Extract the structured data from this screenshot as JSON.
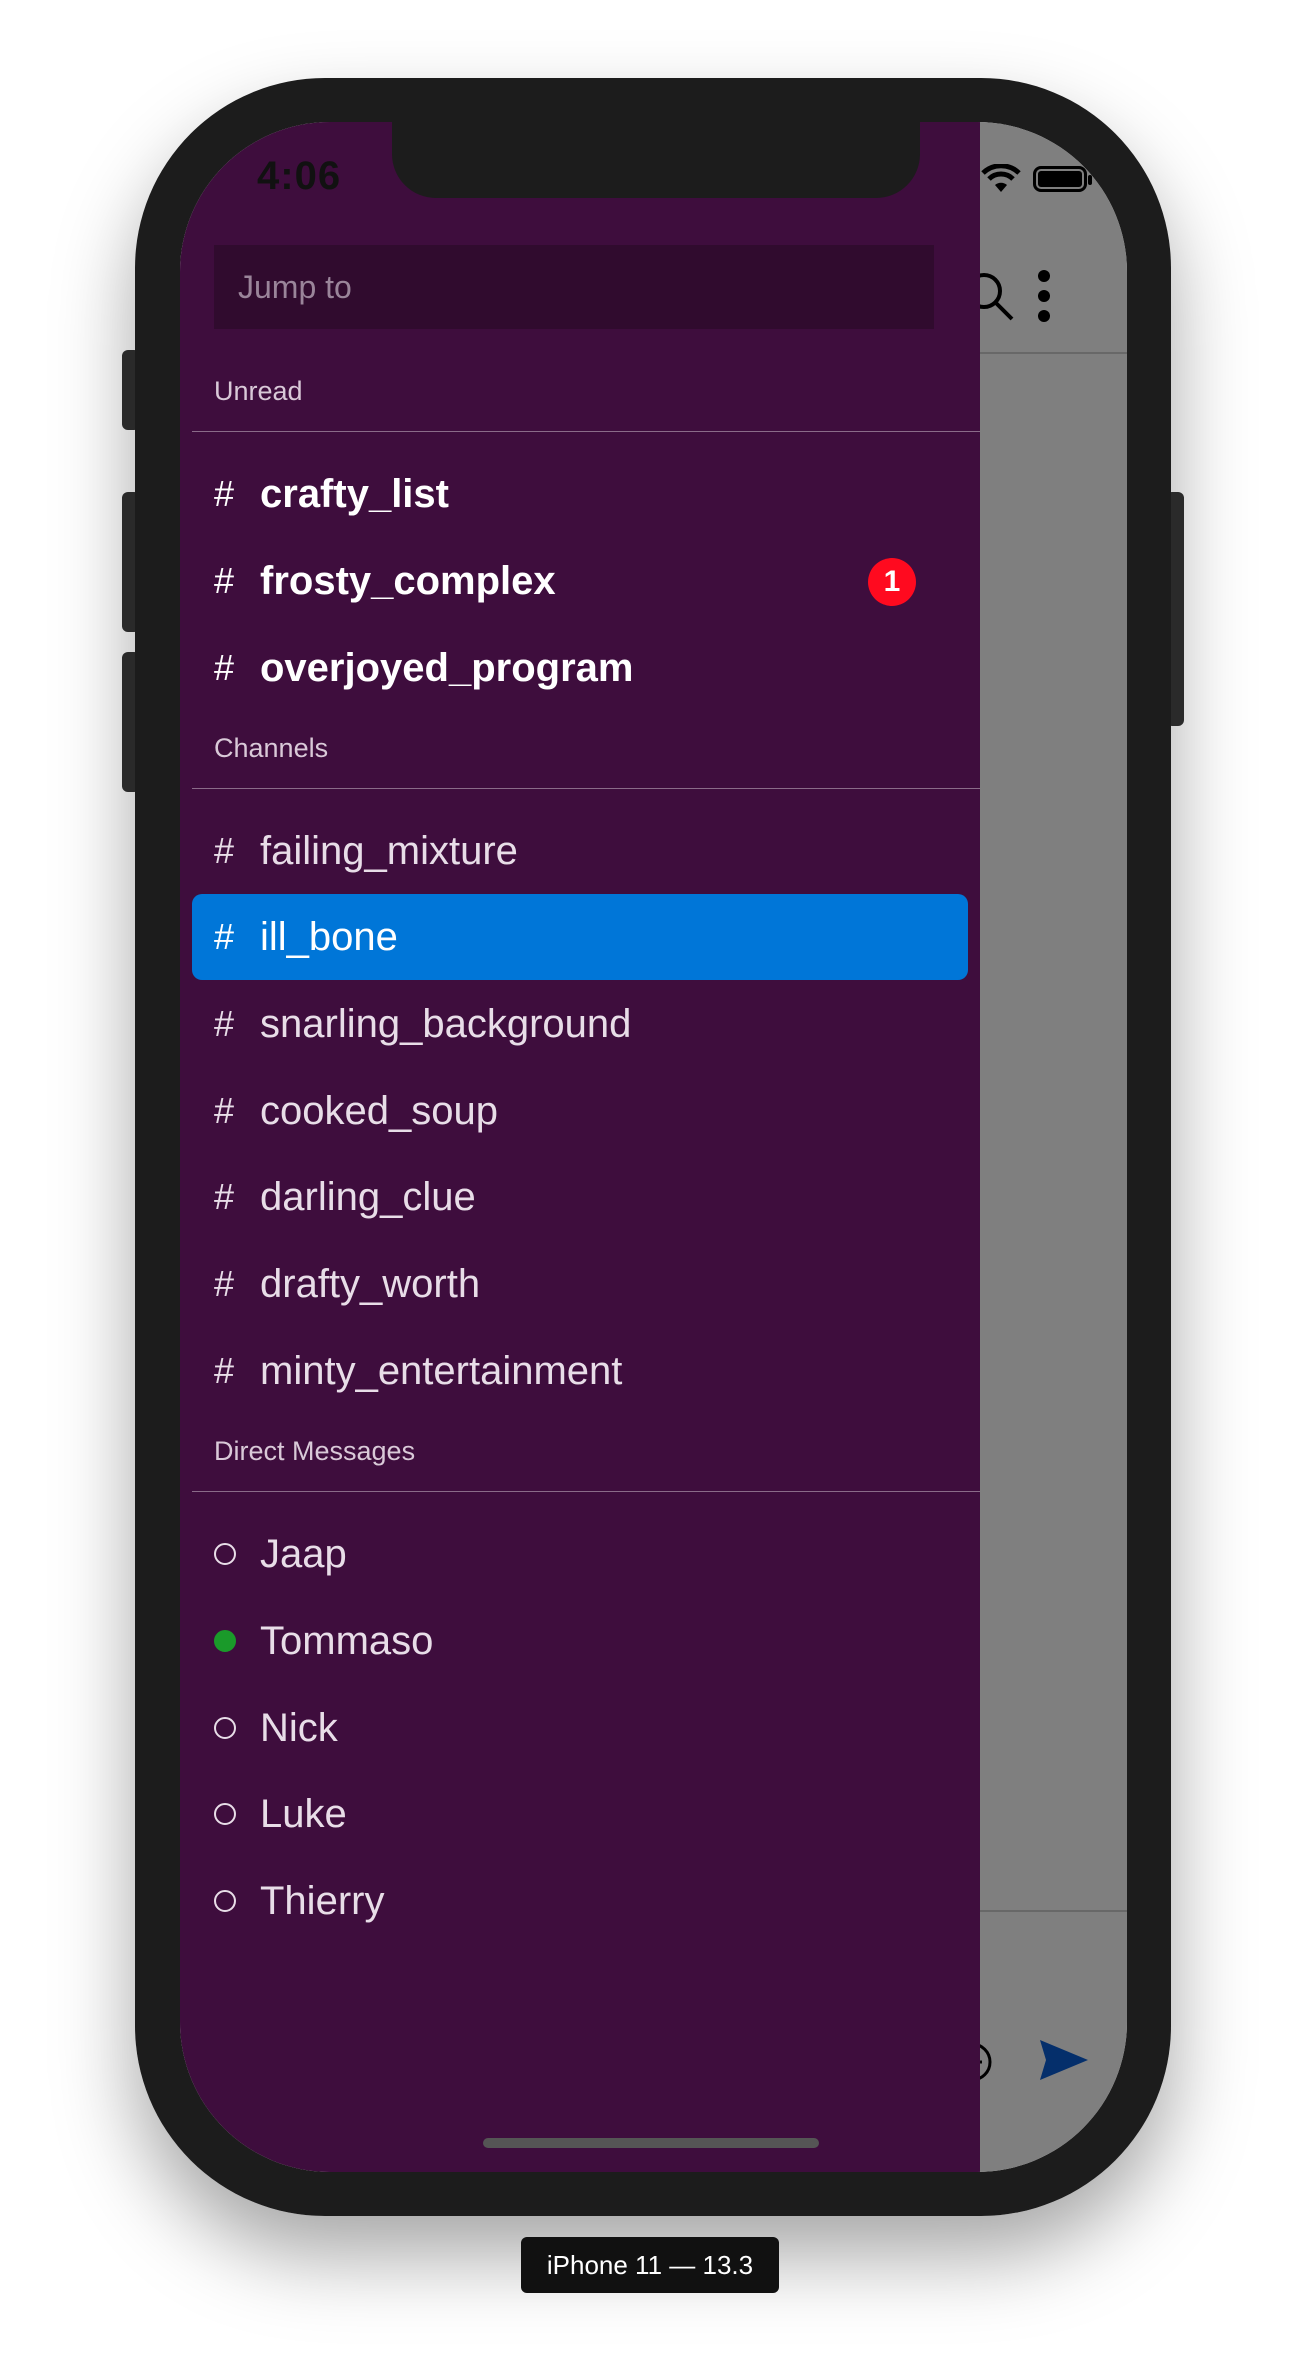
{
  "status_bar": {
    "time": "4:06"
  },
  "drawer": {
    "search": {
      "placeholder": "Jump to"
    },
    "sections": {
      "unread": {
        "label": "Unread",
        "channels": [
          {
            "name": "crafty_list",
            "badge": ""
          },
          {
            "name": "frosty_complex",
            "badge": "1"
          },
          {
            "name": "overjoyed_program",
            "badge": ""
          }
        ]
      },
      "channels": {
        "label": "Channels",
        "items": [
          {
            "name": "failing_mixture",
            "selected": false
          },
          {
            "name": "ill_bone",
            "selected": true
          },
          {
            "name": "snarling_background",
            "selected": false
          },
          {
            "name": "cooked_soup",
            "selected": false
          },
          {
            "name": "darling_clue",
            "selected": false
          },
          {
            "name": "drafty_worth",
            "selected": false
          },
          {
            "name": "minty_entertainment",
            "selected": false
          }
        ]
      },
      "direct_messages": {
        "label": "Direct Messages",
        "users": [
          {
            "name": "Jaap",
            "online": false
          },
          {
            "name": "Tommaso",
            "online": true
          },
          {
            "name": "Nick",
            "online": false
          },
          {
            "name": "Luke",
            "online": false
          },
          {
            "name": "Thierry",
            "online": false
          }
        ]
      }
    },
    "hash_symbol": "#"
  },
  "colors": {
    "drawer_bg": "#3e0d3d",
    "selected_bg": "#0076d8",
    "badge": "#ff0a1f",
    "online": "#1a9a2a"
  },
  "device_label": "iPhone 11 — 13.3"
}
